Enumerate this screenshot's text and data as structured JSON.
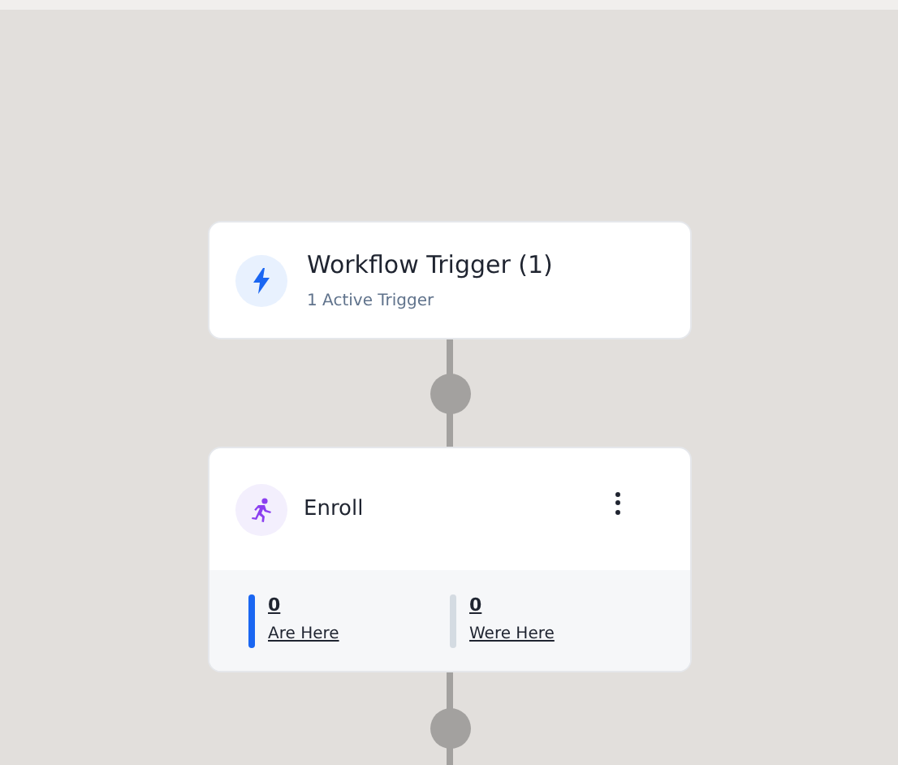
{
  "trigger": {
    "title": "Workflow Trigger (1)",
    "subtitle": "1 Active Trigger"
  },
  "action": {
    "title": "Enroll",
    "stats": [
      {
        "count": "0",
        "label": "Are Here",
        "color": "#1a66f2"
      },
      {
        "count": "0",
        "label": "Were Here",
        "color": "#d4dbe2"
      }
    ]
  }
}
